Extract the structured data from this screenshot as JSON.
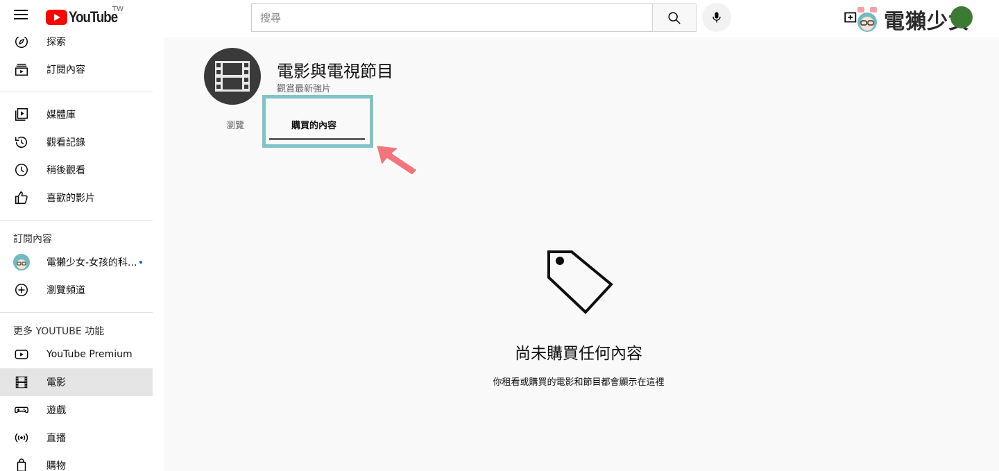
{
  "header": {
    "logo_text": "YouTube",
    "region": "TW",
    "search_placeholder": "搜尋",
    "watermark": "電獺少女"
  },
  "sidebar": {
    "top_items": [
      {
        "label": "探索",
        "icon": "compass-icon"
      },
      {
        "label": "訂閱內容",
        "icon": "subscriptions-icon"
      }
    ],
    "library_items": [
      {
        "label": "媒體庫",
        "icon": "library-icon"
      },
      {
        "label": "觀看記錄",
        "icon": "history-icon"
      },
      {
        "label": "稍後觀看",
        "icon": "clock-icon"
      },
      {
        "label": "喜歡的影片",
        "icon": "thumbs-up-icon"
      }
    ],
    "subscriptions_title": "訂閱內容",
    "subscriptions": [
      {
        "label": "電獺少女-女孩的科...",
        "icon": "channel-avatar",
        "new": true
      },
      {
        "label": "瀏覽頻道",
        "icon": "add-circle-icon"
      }
    ],
    "more_title": "更多 YOUTUBE 功能",
    "more_items": [
      {
        "label": "YouTube Premium",
        "icon": "youtube-icon"
      },
      {
        "label": "電影",
        "icon": "film-icon",
        "active": true
      },
      {
        "label": "遊戲",
        "icon": "gamepad-icon"
      },
      {
        "label": "直播",
        "icon": "live-icon"
      },
      {
        "label": "購物",
        "icon": "shopping-icon"
      }
    ]
  },
  "channel": {
    "title": "電影與電視節目",
    "subtitle": "觀賞最新強片"
  },
  "tabs": {
    "browse": "瀏覽",
    "purchased": "購買的內容"
  },
  "empty_state": {
    "icon": "tag-icon",
    "title": "尚未購買任何內容",
    "subtitle": "你租看或購買的電影和節目都會顯示在這裡"
  },
  "colors": {
    "accent": "#ff0000",
    "highlight_box": "#7fc4c6",
    "pointer_arrow": "#f4747b",
    "main_bg": "#f9f9f9"
  }
}
